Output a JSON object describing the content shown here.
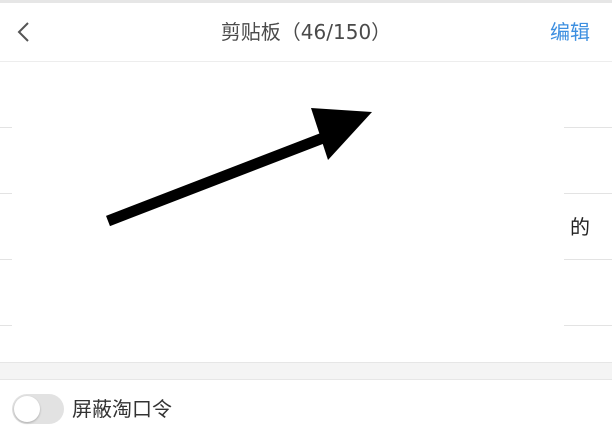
{
  "header": {
    "back_icon": "chevron-left-icon",
    "title": "剪贴板（46/150）",
    "edit_label": "编辑",
    "accent_color": "#3d8fe0"
  },
  "clipboard_items": [
    {
      "text": ""
    },
    {
      "text": ""
    },
    {
      "text": "的"
    },
    {
      "text": ""
    },
    {
      "text": ""
    }
  ],
  "footer": {
    "toggle_label": "屏蔽淘口令",
    "toggle_on": false
  },
  "annotation": {
    "icon": "arrow-up-right-icon",
    "color": "#000000"
  }
}
